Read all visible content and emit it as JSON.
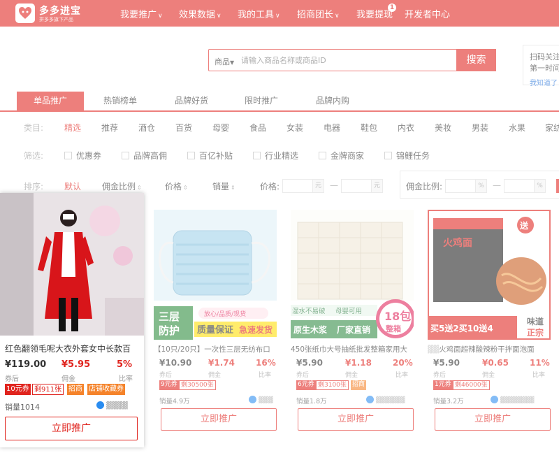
{
  "header": {
    "brand": "多多进宝",
    "brand_sub": "拼多多旗下产品",
    "nav": [
      {
        "label": "我要推广",
        "dropdown": true
      },
      {
        "label": "效果数据",
        "dropdown": true
      },
      {
        "label": "我的工具",
        "dropdown": true
      },
      {
        "label": "招商团长",
        "dropdown": true
      },
      {
        "label": "我要提现",
        "dropdown": false
      },
      {
        "label": "开发者中心",
        "dropdown": false
      }
    ],
    "withdraw_badge": "1",
    "brand_color": "#e0241e"
  },
  "search": {
    "category": "商品",
    "placeholder": "请输入商品名称或商品ID",
    "button": "搜索"
  },
  "qr": {
    "line1": "扫码关注",
    "line2": "第一时间",
    "link": "我知道了"
  },
  "tabs": [
    "单品推广",
    "热销榜单",
    "品牌好货",
    "限时推广",
    "品牌内购"
  ],
  "active_tab": 0,
  "category_label": "类目:",
  "categories": [
    "精选",
    "推荐",
    "酒仓",
    "百货",
    "母婴",
    "食品",
    "女装",
    "电器",
    "鞋包",
    "内衣",
    "美妆",
    "男装",
    "水果",
    "家纺"
  ],
  "filter_label": "筛选:",
  "filters": [
    "优惠券",
    "品牌高佣",
    "百亿补贴",
    "行业精选",
    "金牌商家",
    "锦鲤任务"
  ],
  "sort": {
    "label": "排序:",
    "options": [
      "默认",
      "佣金比例",
      "价格",
      "销量"
    ],
    "price_label": "价格:",
    "commission_label": "佣金比例:",
    "unit_yuan": "元",
    "unit_pct": "%",
    "dash": "—"
  },
  "labels": {
    "after_coupon": "券后",
    "commission": "佣金",
    "rate": "比率",
    "promote": "立即推广"
  },
  "products": [
    {
      "title": "红色翻领毛呢大衣外套女中长款百",
      "price": "¥119.00",
      "commission": "¥5.95",
      "rate": "5%",
      "tags": [
        {
          "text": "10元券",
          "style": "solid"
        },
        {
          "text": "剩911张",
          "style": "out"
        },
        {
          "text": "招商",
          "style": "orange"
        },
        {
          "text": "店铺收藏券",
          "style": "orange"
        }
      ],
      "sales": "销量1014",
      "highlighted": true
    },
    {
      "title": "【10只/20只】一次性三层无纺布口",
      "price": "¥10.90",
      "commission": "¥1.74",
      "rate": "16%",
      "tags": [
        {
          "text": "9元券",
          "style": "solid"
        },
        {
          "text": "剩30500张",
          "style": "out"
        }
      ],
      "sales": "销量4.9万",
      "image_text": {
        "a": "三层",
        "b": "防护",
        "c": "放心/品质/现货",
        "d": "质量保证",
        "e": "急速发货"
      }
    },
    {
      "title": "450张纸巾大号抽纸批发整箱家用大",
      "price": "¥5.90",
      "commission": "¥1.18",
      "rate": "20%",
      "tags": [
        {
          "text": "6元券",
          "style": "solid"
        },
        {
          "text": "剩3100张",
          "style": "out"
        },
        {
          "text": "招商",
          "style": "orange"
        }
      ],
      "sales": "销量1.8万",
      "image_text": {
        "a": "湿水不易破",
        "b": "母婴可用",
        "c": "原生木浆",
        "d": "厂家直销",
        "e": "18包",
        "f": "整箱"
      }
    },
    {
      "title": "火鸡面超辣酸辣粉干拌面泡面",
      "price": "¥5.90",
      "commission": "¥0.65",
      "rate": "11%",
      "tags": [
        {
          "text": "1元券",
          "style": "solid"
        },
        {
          "text": "剩46000张",
          "style": "out"
        }
      ],
      "sales": "销量3.2万",
      "image_text": {
        "a": "买5送2买10送4",
        "b": "味道",
        "c": "正宗",
        "d": "送",
        "e": "火鸡面"
      }
    }
  ]
}
